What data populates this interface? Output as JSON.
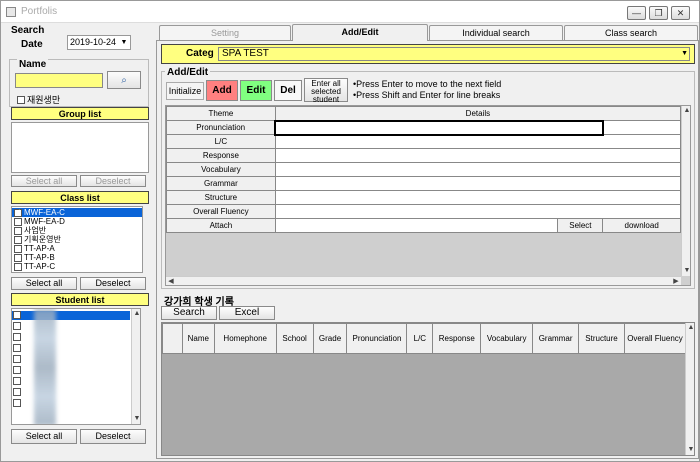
{
  "window": {
    "title": "Portfolis",
    "minimize": "—",
    "restore": "❐",
    "close": "✕"
  },
  "left": {
    "search_label": "Search",
    "date_label": "Date",
    "date_value": "2019-10-24",
    "name_label": "Name",
    "name_value": "",
    "search_icon": "binoculars-icon",
    "enrolled_only_label": "재원생만",
    "group_list_title": "Group list",
    "group_select_all": "Select all",
    "group_deselect": "Deselect",
    "class_list_title": "Class list",
    "class_items": [
      {
        "label": "MWF-EA-C",
        "checked": true,
        "selected": true
      },
      {
        "label": "MWF-EA-D",
        "checked": false,
        "selected": false
      },
      {
        "label": "사업반",
        "checked": false,
        "selected": false
      },
      {
        "label": "기획운영반",
        "checked": false,
        "selected": false
      },
      {
        "label": "TT-AP-A",
        "checked": false,
        "selected": false
      },
      {
        "label": "TT-AP-B",
        "checked": false,
        "selected": false
      },
      {
        "label": "TT-AP-C",
        "checked": false,
        "selected": false
      }
    ],
    "class_select_all": "Select all",
    "class_deselect": "Deselect",
    "student_list_title": "Student list",
    "student_select_all": "Select all",
    "student_deselect": "Deselect"
  },
  "tabs": [
    "Setting",
    "Add/Edit",
    "Individual search",
    "Class search"
  ],
  "active_tab": "Add/Edit",
  "categ": {
    "label": "Categ",
    "value": "SPA TEST"
  },
  "addedit": {
    "title": "Add/Edit",
    "initialize": "Initialize",
    "add": "Add",
    "edit": "Edit",
    "del": "Del",
    "enter_all_line1": "Enter all",
    "enter_all_line2": "selected",
    "enter_all_line3": "student",
    "hint1": "•Press Enter to move to the next field",
    "hint2": "•Press Shift and Enter for line breaks",
    "col_theme": "Theme",
    "col_details": "Details",
    "rows": [
      "Pronunciation",
      "L/C",
      "Response",
      "Vocabulary",
      "Grammar",
      "Structure",
      "Overall Fluency",
      "Attach"
    ],
    "attach_select": "Select",
    "attach_download": "download"
  },
  "records": {
    "title": "강가희 학생 기록",
    "search": "Search",
    "excel": "Excel",
    "columns": [
      "Name",
      "Homephone",
      "School",
      "Grade",
      "Pronunciation",
      "L/C",
      "Response",
      "Vocabulary",
      "Grammar",
      "Structure",
      "Overall Fluency"
    ]
  },
  "colors": {
    "yellow": "#ffff80",
    "add_red": "#ff8080",
    "edit_green": "#80ff80",
    "selection_blue": "#0a64d8"
  }
}
